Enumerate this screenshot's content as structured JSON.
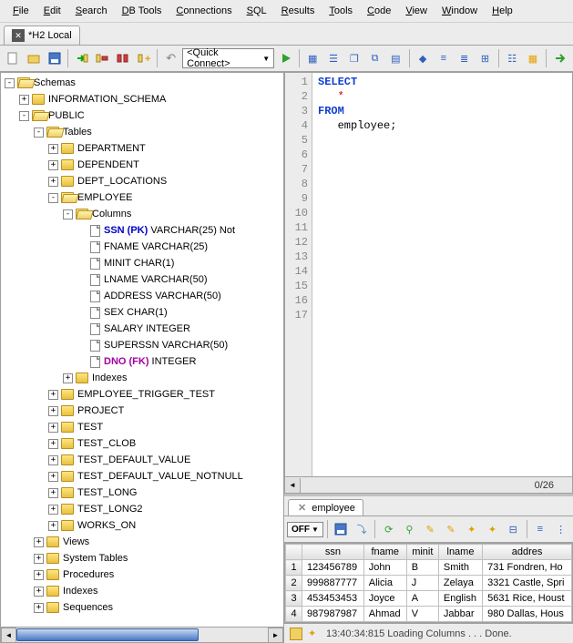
{
  "menubar": [
    "File",
    "Edit",
    "Search",
    "DB Tools",
    "Connections",
    "SQL",
    "Results",
    "Tools",
    "Code",
    "View",
    "Window",
    "Help"
  ],
  "tab": {
    "label": "*H2 Local"
  },
  "quick_connect": "<Quick Connect>",
  "tree": {
    "root": "Schemas",
    "nodes": [
      {
        "label": "INFORMATION_SCHEMA",
        "d": 1,
        "exp": "+",
        "icon": "folder"
      },
      {
        "label": "PUBLIC",
        "d": 1,
        "exp": "-",
        "icon": "folder-open"
      },
      {
        "label": "Tables",
        "d": 2,
        "exp": "-",
        "icon": "folder-open"
      },
      {
        "label": "DEPARTMENT",
        "d": 3,
        "exp": "+",
        "icon": "folder"
      },
      {
        "label": "DEPENDENT",
        "d": 3,
        "exp": "+",
        "icon": "folder"
      },
      {
        "label": "DEPT_LOCATIONS",
        "d": 3,
        "exp": "+",
        "icon": "folder"
      },
      {
        "label": "EMPLOYEE",
        "d": 3,
        "exp": "-",
        "icon": "folder-open"
      },
      {
        "label": "Columns",
        "d": 4,
        "exp": "-",
        "icon": "folder-open"
      },
      {
        "label": "SSN (PK)",
        "suffix": " VARCHAR(25) Not",
        "d": 5,
        "icon": "file",
        "cls": "pk"
      },
      {
        "label": "FNAME",
        "suffix": " VARCHAR(25)",
        "d": 5,
        "icon": "file"
      },
      {
        "label": "MINIT",
        "suffix": " CHAR(1)",
        "d": 5,
        "icon": "file"
      },
      {
        "label": "LNAME",
        "suffix": " VARCHAR(50)",
        "d": 5,
        "icon": "file"
      },
      {
        "label": "ADDRESS",
        "suffix": " VARCHAR(50)",
        "d": 5,
        "icon": "file"
      },
      {
        "label": "SEX",
        "suffix": " CHAR(1)",
        "d": 5,
        "icon": "file"
      },
      {
        "label": "SALARY",
        "suffix": " INTEGER",
        "d": 5,
        "icon": "file"
      },
      {
        "label": "SUPERSSN",
        "suffix": " VARCHAR(50)",
        "d": 5,
        "icon": "file"
      },
      {
        "label": "DNO (FK)",
        "suffix": " INTEGER",
        "d": 5,
        "icon": "file",
        "cls": "fk"
      },
      {
        "label": "Indexes",
        "d": 4,
        "exp": "+",
        "icon": "folder"
      },
      {
        "label": "EMPLOYEE_TRIGGER_TEST",
        "d": 3,
        "exp": "+",
        "icon": "folder"
      },
      {
        "label": "PROJECT",
        "d": 3,
        "exp": "+",
        "icon": "folder"
      },
      {
        "label": "TEST",
        "d": 3,
        "exp": "+",
        "icon": "folder"
      },
      {
        "label": "TEST_CLOB",
        "d": 3,
        "exp": "+",
        "icon": "folder"
      },
      {
        "label": "TEST_DEFAULT_VALUE",
        "d": 3,
        "exp": "+",
        "icon": "folder"
      },
      {
        "label": "TEST_DEFAULT_VALUE_NOTNULL",
        "d": 3,
        "exp": "+",
        "icon": "folder"
      },
      {
        "label": "TEST_LONG",
        "d": 3,
        "exp": "+",
        "icon": "folder"
      },
      {
        "label": "TEST_LONG2",
        "d": 3,
        "exp": "+",
        "icon": "folder"
      },
      {
        "label": "WORKS_ON",
        "d": 3,
        "exp": "+",
        "icon": "folder"
      },
      {
        "label": "Views",
        "d": 2,
        "exp": "+",
        "icon": "folder"
      },
      {
        "label": "System Tables",
        "d": 2,
        "exp": "+",
        "icon": "folder"
      },
      {
        "label": "Procedures",
        "d": 2,
        "exp": "+",
        "icon": "folder"
      },
      {
        "label": "Indexes",
        "d": 2,
        "exp": "+",
        "icon": "folder"
      },
      {
        "label": "Sequences",
        "d": 2,
        "exp": "+",
        "icon": "folder"
      }
    ]
  },
  "editor": {
    "lines": 17,
    "pos": "0/26",
    "code_kw1": "SELECT",
    "code_star": "*",
    "code_kw2": "FROM",
    "code_txt": "employee;"
  },
  "results": {
    "tab": "employee",
    "off": "OFF",
    "columns": [
      "ssn",
      "fname",
      "minit",
      "lname",
      "addres"
    ],
    "rows": [
      [
        "123456789",
        "John",
        "B",
        "Smith",
        "731 Fondren, Ho"
      ],
      [
        "999887777",
        "Alicia",
        "J",
        "Zelaya",
        "3321 Castle, Spri"
      ],
      [
        "453453453",
        "Joyce",
        "A",
        "English",
        "5631 Rice, Houst"
      ],
      [
        "987987987",
        "Ahmad",
        "V",
        "Jabbar",
        "980 Dallas, Hous"
      ]
    ]
  },
  "status": "13:40:34:815 Loading Columns . . . Done."
}
